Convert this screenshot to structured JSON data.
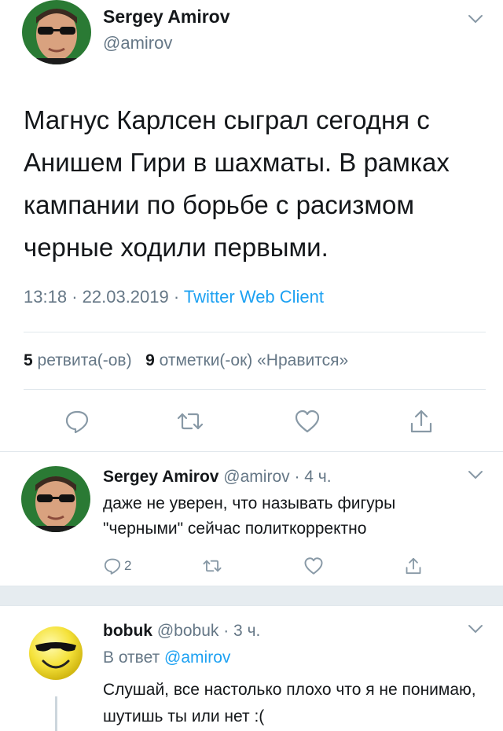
{
  "main_tweet": {
    "author_name": "Sergey Amirov",
    "author_handle": "@amirov",
    "text": "Магнус Карлсен сыграл сегодня с Анишем Гири в шахматы. В рамках кампании по борьбе с расизмом черные ходили первыми.",
    "time": "13:18",
    "date": "22.03.2019",
    "dot": "·",
    "client": "Twitter Web Client",
    "retweets_count": "5",
    "retweets_label": "ретвита(-ов)",
    "likes_count": "9",
    "likes_label": "отметки(-ок) «Нравится»",
    "actions": [
      "reply-icon",
      "retweet-icon",
      "like-icon",
      "share-icon"
    ]
  },
  "reply_1": {
    "author_name": "Sergey Amirov",
    "author_handle": "@amirov",
    "age": "· 4 ч.",
    "text": "даже не уверен, что называть фигуры \"черными\" сейчас политкорректно",
    "reply_count": "2"
  },
  "reply_2": {
    "author_name": "bobuk",
    "author_handle": "@bobuk",
    "age": "· 3 ч.",
    "reply_to_label": "В ответ",
    "reply_to_handle": "@amirov",
    "text": "Слушай, все настолько плохо что я не понимаю, шутишь ты или нет :("
  },
  "colors": {
    "text": "#14171a",
    "secondary": "#657786",
    "link": "#1da1f2",
    "divider": "#e1e8ed",
    "icon": "#8899a6",
    "gap": "#e6ecf0"
  }
}
